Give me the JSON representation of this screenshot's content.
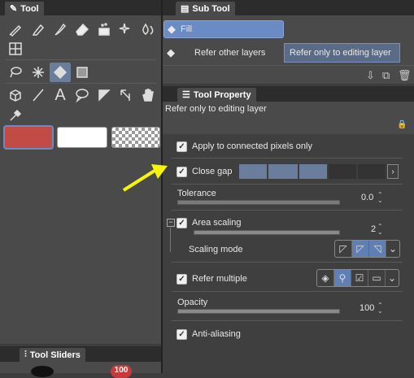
{
  "tool_panel": {
    "title": "Tool",
    "row1_icons": [
      "pen-icon",
      "pencil-icon",
      "brush-icon",
      "eraser-icon",
      "decoration-icon",
      "sparkle-icon",
      "blend-icon"
    ],
    "row2_icons": [
      "select-transform-icon"
    ],
    "row3_icons": [
      "lasso-icon",
      "magic-wand-icon",
      "fill-icon",
      "gradient-icon"
    ],
    "row4_icons": [
      "operation-icon",
      "line-icon",
      "text-icon",
      "balloon-icon",
      "ruler-icon",
      "correct-line-icon",
      "hand-icon"
    ],
    "row5_icons": [
      "eyedropper-icon"
    ],
    "colors": {
      "main": "#c24b45",
      "sub": "#ffffff",
      "transparent": "checker"
    }
  },
  "tool_sliders": {
    "title": "Tool Sliders",
    "badge": "100"
  },
  "sub_tool": {
    "title": "Sub Tool",
    "items": [
      {
        "label": "Fill",
        "selected": true
      },
      {
        "label": "Refer other layers",
        "selected": false
      },
      {
        "label": "Refer only to editing layer",
        "selected": true
      }
    ]
  },
  "tool_property": {
    "title": "Tool Property",
    "subtitle": "Refer only to editing layer",
    "apply_connected": "Apply to connected pixels only",
    "close_gap": "Close gap",
    "close_gap_level": 3,
    "tolerance_label": "Tolerance",
    "tolerance_value": "0.0",
    "area_scaling": "Area scaling",
    "area_scaling_value": "2",
    "scaling_mode": "Scaling mode",
    "refer_multiple": "Refer multiple",
    "opacity_label": "Opacity",
    "opacity_value": "100",
    "anti_aliasing": "Anti-aliasing"
  },
  "colors": {
    "accent": "#6b7d9c",
    "arrow": "#f5f50a"
  }
}
